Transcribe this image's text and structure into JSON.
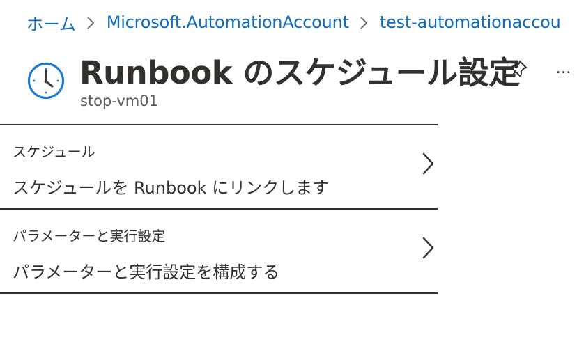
{
  "breadcrumb": {
    "items": [
      {
        "label": "ホーム"
      },
      {
        "label": "Microsoft.AutomationAccount"
      },
      {
        "label": "test-automationaccou"
      }
    ]
  },
  "header": {
    "icon": "clock-icon",
    "title": "Runbook のスケジュール設定",
    "subtitle": "stop-vm01",
    "actions": [
      {
        "icon": "pin-icon"
      },
      {
        "icon": "more-icon",
        "label": "…"
      }
    ]
  },
  "settings": [
    {
      "label": "スケジュール",
      "value": "スケジュールを Runbook にリンクします",
      "icon": "chevron-right-icon"
    },
    {
      "label": "パラメーターと実行設定",
      "value": "パラメーターと実行設定を構成する",
      "icon": "chevron-right-icon"
    }
  ],
  "colors": {
    "link": "#0f6cbd",
    "text": "#323130",
    "subtext": "#605e5c",
    "icon_accent": "#1f7ad1"
  }
}
